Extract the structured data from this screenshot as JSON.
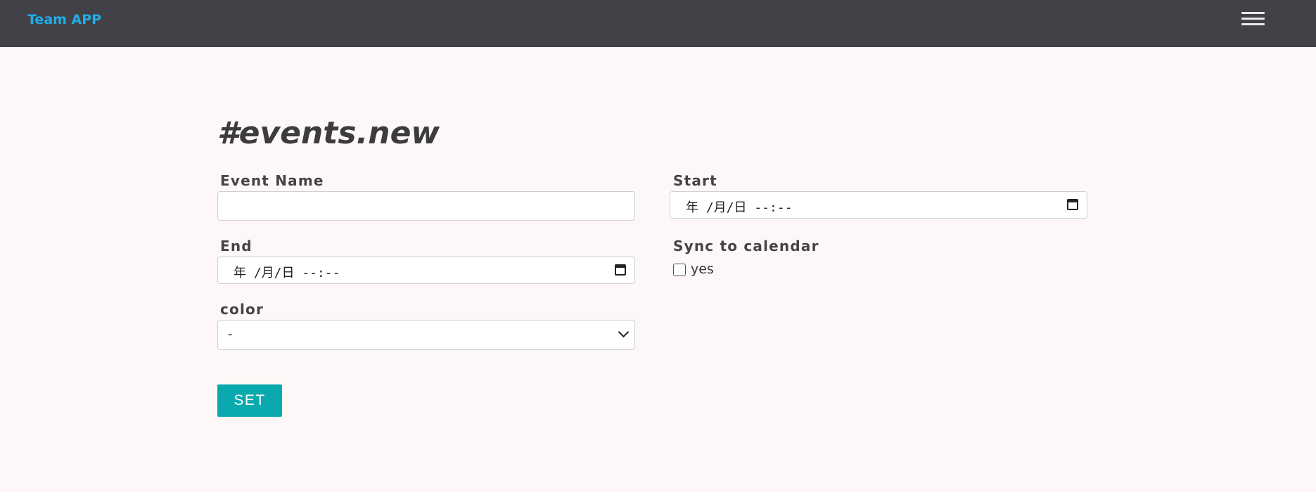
{
  "navbar": {
    "brand": "Team APP",
    "menu_icon": "hamburger-menu-icon",
    "background": "#424147",
    "brand_color": "#1faee9"
  },
  "page": {
    "title": "#events.new",
    "background": "#fdf8f7"
  },
  "form": {
    "event_name": {
      "label": "Event Name",
      "value": ""
    },
    "start": {
      "label": "Start",
      "display": "年 /月/日 --:--"
    },
    "end": {
      "label": "End",
      "display": "年 /月/日 --:--"
    },
    "sync": {
      "label": "Sync to calendar",
      "option_label": "yes",
      "checked": false
    },
    "color": {
      "label": "color",
      "selected": "-"
    },
    "submit_label": "SET",
    "submit_color": "#0aa9ad"
  }
}
